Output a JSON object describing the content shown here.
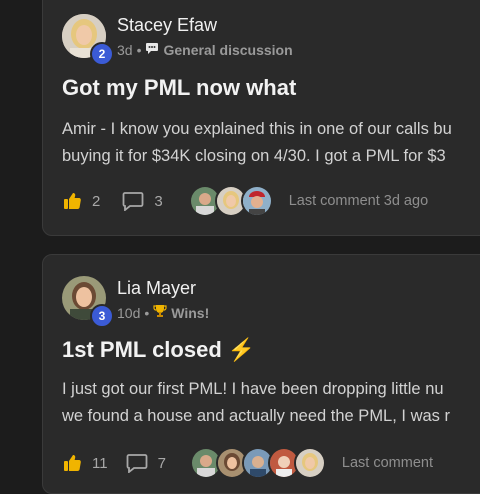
{
  "posts": [
    {
      "author": "Stacey Efaw",
      "level": "2",
      "time": "3d",
      "sep": "•",
      "category": "General discussion",
      "title": "Got my PML now what",
      "body_line1": "Amir - I know you explained this in one of our calls bu",
      "body_line2": "buying it for $34K closing on 4/30. I got a PML for $3",
      "likes": "2",
      "comments": "3",
      "last_comment": "Last comment 3d ago"
    },
    {
      "author": "Lia Mayer",
      "level": "3",
      "time": "10d",
      "sep": "•",
      "category": "Wins!",
      "category_icon": "trophy-icon",
      "title": "1st PML closed",
      "title_emoji": "⚡",
      "body_line1": "I just got our first PML! I have been dropping little nu",
      "body_line2": "we found a house and actually need the PML, I was r",
      "likes": "11",
      "comments": "7",
      "last_comment": "Last comment"
    }
  ],
  "colors": {
    "accent": "#f0b400",
    "badge": "#3b5bd6",
    "card": "#2a2a2a",
    "background": "#1c1c1c"
  }
}
